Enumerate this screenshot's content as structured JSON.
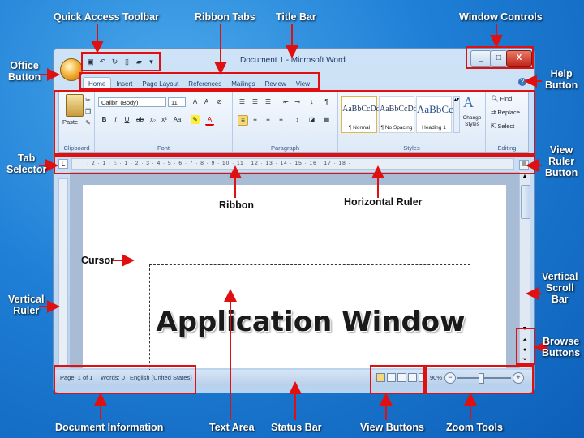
{
  "window": {
    "title": "Document 1 - Microsoft Word",
    "quick_access": [
      "save-icon",
      "undo-icon",
      "redo-icon",
      "new-icon",
      "open-icon",
      "customize-icon"
    ],
    "controls": {
      "minimize": "_",
      "maximize": "□",
      "close": "X"
    }
  },
  "ribbon_tabs": [
    "Home",
    "Insert",
    "Page Layout",
    "References",
    "Mailings",
    "Review",
    "View"
  ],
  "ribbon": {
    "clipboard": {
      "paste": "Paste",
      "name": "Clipboard"
    },
    "font": {
      "family": "Calibri (Body)",
      "size": "11",
      "name": "Font"
    },
    "paragraph": {
      "name": "Paragraph"
    },
    "styles": {
      "items": [
        {
          "preview": "AaBbCcDd",
          "name": "¶ Normal"
        },
        {
          "preview": "AaBbCcDd",
          "name": "¶ No Spacing"
        },
        {
          "preview": "AaBbCc",
          "name": "Heading 1"
        }
      ],
      "change_styles": "Change Styles",
      "name": "Styles"
    },
    "editing": {
      "find": "Find",
      "replace": "Replace",
      "select": "Select",
      "name": "Editing"
    }
  },
  "ruler_numbers": "· 2 · 1 · ⌂ · 1 · 2 · 3 · 4 · 5 · 6 · 7 · 8 · 9 · 10 · 11 · 12 · 13 · 14 · 15 · 16 · 17 · 18 ·",
  "tab_selector_symbol": "L",
  "document": {
    "text": "Application Window"
  },
  "statusbar": {
    "page": "Page: 1 of 1",
    "words": "Words: 0",
    "language": "English (United States)",
    "zoom": "90%"
  },
  "callouts": {
    "quick_access_toolbar": "Quick Access Toolbar",
    "ribbon_tabs": "Ribbon Tabs",
    "title_bar": "Title Bar",
    "window_controls": "Window Controls",
    "office_button": "Office\nButton",
    "help_button": "Help\nButton",
    "tab_selector": "Tab\nSelector",
    "view_ruler_button": "View\nRuler\nButton",
    "ribbon": "Ribbon",
    "horizontal_ruler": "Horizontal Ruler",
    "cursor": "Cursor",
    "vertical_ruler": "Vertical\nRuler",
    "vertical_scroll_bar": "Vertical\nScroll\nBar",
    "browse_buttons": "Browse\nButtons",
    "document_information": "Document Information",
    "text_area": "Text Area",
    "status_bar": "Status Bar",
    "view_buttons": "View Buttons",
    "zoom_tools": "Zoom Tools"
  },
  "colors": {
    "background": "#1f7fd6",
    "callout_box": "#e01010",
    "arrow": "#e01010"
  }
}
